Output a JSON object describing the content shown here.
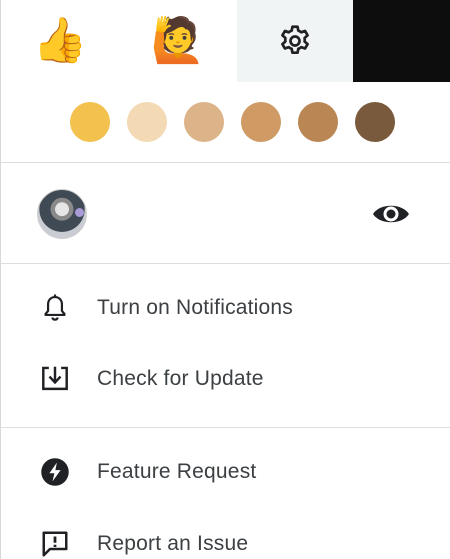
{
  "tabs": {
    "reaction_emoji": "👍",
    "gesture_emoji": "🙋",
    "settings_icon": "gear-icon"
  },
  "skin_tones": [
    {
      "name": "default",
      "color": "#F2C14E"
    },
    {
      "name": "light",
      "color": "#F3D9B4"
    },
    {
      "name": "medium-light",
      "color": "#DDB38A"
    },
    {
      "name": "medium",
      "color": "#CF9A64"
    },
    {
      "name": "medium-dark",
      "color": "#B98654"
    },
    {
      "name": "dark",
      "color": "#7A5A3C"
    }
  ],
  "profile": {
    "visibility_icon": "eye-icon"
  },
  "menu": {
    "notifications_label": "Turn on Notifications",
    "update_label": "Check for Update",
    "feature_label": "Feature Request",
    "issue_label": "Report an Issue"
  },
  "colors": {
    "text": "#3C4043",
    "icon": "#202124",
    "active_tab_bg": "#F1F4F5",
    "dark_tab_bg": "#0D0D0D"
  }
}
